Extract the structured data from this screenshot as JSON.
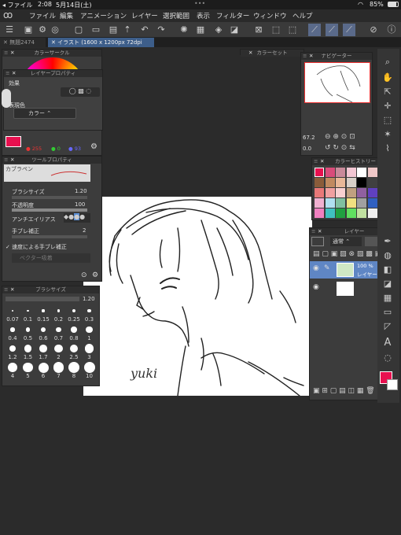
{
  "status": {
    "app": "ファイル",
    "time": "2:08",
    "date": "5月14日(土)",
    "battery": "85%"
  },
  "menu": [
    "ファイル",
    "編集",
    "アニメーション",
    "レイヤー",
    "選択範囲",
    "表示",
    "フィルター",
    "ウィンドウ",
    "ヘルプ"
  ],
  "tabs": [
    {
      "label": "無題2474"
    },
    {
      "label": "イラスト (1600 x 1200px 72dpi 67.2%)"
    }
  ],
  "panels": {
    "color_circle": "カラーサークル",
    "layer_property": "レイヤープロパティ",
    "effect": "効果",
    "expression_color": "表現色",
    "color_mode": "カラー",
    "color_set": "カラーセット",
    "navigator": "ナビゲーター",
    "tool_property": "ツールプロパティ",
    "color_history": "カラーヒストリー",
    "layer": "レイヤー",
    "brush_size": "ブラシサイズ"
  },
  "color_values": {
    "r": "255",
    "g": "0",
    "b": "93"
  },
  "tool": {
    "name": "カブラペン",
    "brush_size_label": "ブラシサイズ",
    "brush_size": "1.20",
    "opacity_label": "不透明度",
    "opacity": "100",
    "antialias_label": "アンチエイリアス",
    "stabilization_label": "手ブレ補正",
    "stabilization": "2",
    "speed_label": "速度による手ブレ補正",
    "vector_label": "ベクター吸着"
  },
  "navigator": {
    "zoom": "67.2",
    "angle": "0.0"
  },
  "layers": {
    "blend": "通常",
    "opacity": "100 %",
    "name": "レイヤー"
  },
  "brush_sizes": {
    "current": "1.20",
    "values": [
      "0.07",
      "0.1",
      "0.15",
      "0.2",
      "0.25",
      "0.3",
      "0.4",
      "0.5",
      "0.6",
      "0.7",
      "0.8",
      "1",
      "1.2",
      "1.5",
      "1.7",
      "2",
      "2.5",
      "3",
      "4",
      "5",
      "6",
      "7",
      "8",
      "10"
    ]
  },
  "colors": {
    "main": "#e8104f",
    "accent": "#5a8fd6"
  },
  "history_colors": [
    "#e8104f",
    "#d94c7a",
    "#c98a9a",
    "#f2c6d2",
    "#ffffff",
    "#f0c8c8",
    "#c87060",
    "#a04040",
    "#8a5c3a",
    "#c08a60",
    "#e8b898",
    "#d8d0c8",
    "#000000",
    "#404040",
    "#4a8a3a",
    "#7a4a2a",
    "#e87878",
    "#f0a0a0",
    "#f8d0d0",
    "#c0a080",
    "#9060a0",
    "#6040c0",
    "#4060e0",
    "#40a0e0",
    "#f0b0d0",
    "#b0e0f0",
    "#80c0a0",
    "#f0e080",
    "#a0a0a0",
    "#3060c0",
    "#20c0f0",
    "#e040a0",
    "#f080c0",
    "#40c0c0",
    "#20a040",
    "#60e060",
    "#c0e0a0",
    "#f0f0f0",
    "#4080f0",
    "#3090d0"
  ]
}
